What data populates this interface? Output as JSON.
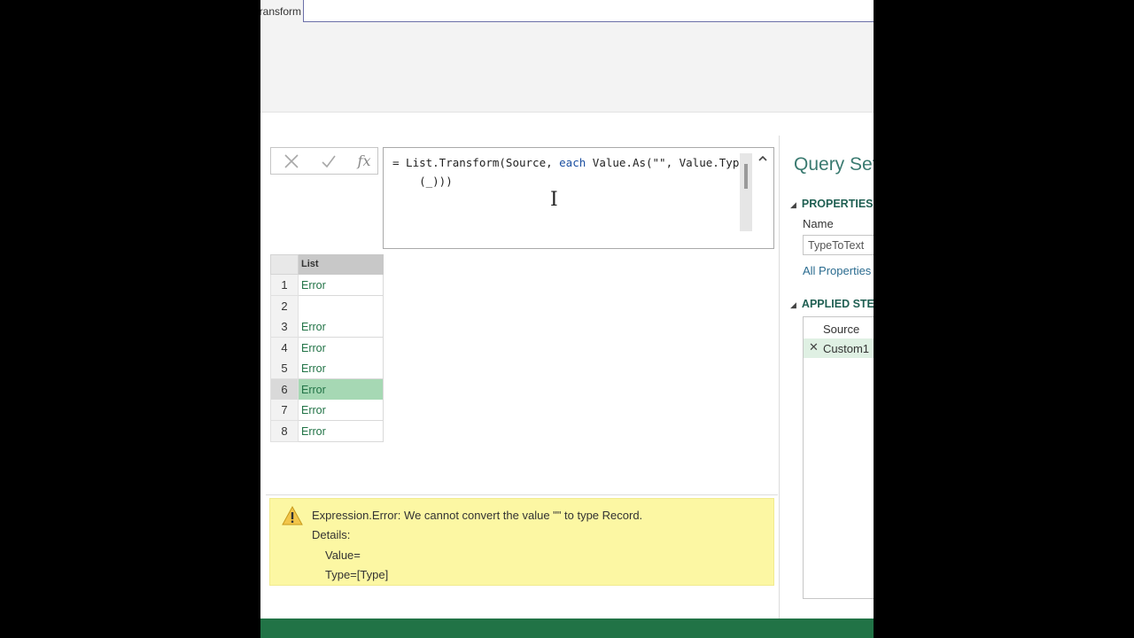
{
  "ribbon": {
    "tab_label": "Transform"
  },
  "formula_bar": {
    "cancel_icon": "x-icon",
    "commit_icon": "check-icon",
    "fx_label": "fx",
    "formula_prefix": "= List.Transform(Source, ",
    "formula_keyword": "each",
    "formula_suffix": " Value.As(\"\", Value.Type",
    "formula_line2": "    (_)))"
  },
  "grid": {
    "column_header": "List",
    "rows": [
      {
        "num": "1",
        "value": "Error"
      },
      {
        "num": "2",
        "value": ""
      },
      {
        "num": "3",
        "value": "Error"
      },
      {
        "num": "4",
        "value": "Error"
      },
      {
        "num": "5",
        "value": "Error"
      },
      {
        "num": "6",
        "value": "Error"
      },
      {
        "num": "7",
        "value": "Error"
      },
      {
        "num": "8",
        "value": "Error"
      }
    ],
    "selected_row": 6
  },
  "error": {
    "message": "Expression.Error: We cannot convert the value \"\" to type Record.",
    "details_label": "Details:",
    "value_line": "Value=",
    "type_line": "Type=[Type]"
  },
  "query_settings": {
    "title": "Query Settings",
    "properties_header": "PROPERTIES",
    "name_label": "Name",
    "name_value": "TypeToText",
    "all_properties": "All Properties",
    "applied_steps_header": "APPLIED STEPS",
    "steps": [
      {
        "label": "Source"
      },
      {
        "label": "Custom1"
      }
    ]
  },
  "colors": {
    "accent_green": "#217346",
    "error_bg": "#fcf7a3",
    "selected_row": "#a6d8b4"
  }
}
